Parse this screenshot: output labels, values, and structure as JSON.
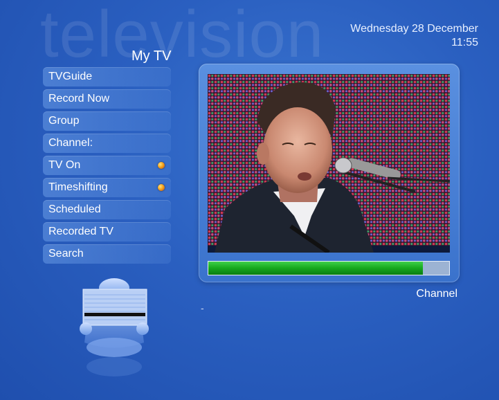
{
  "watermark": "television",
  "header": {
    "date": "Wednesday 28 December",
    "time": "11:55",
    "title": "My TV"
  },
  "menu": [
    {
      "label": "TVGuide",
      "indicator": false
    },
    {
      "label": "Record Now",
      "indicator": false
    },
    {
      "label": "Group",
      "indicator": false
    },
    {
      "label": "Channel:",
      "indicator": false
    },
    {
      "label": "TV On",
      "indicator": true
    },
    {
      "label": "Timeshifting",
      "indicator": true
    },
    {
      "label": "Scheduled",
      "indicator": false
    },
    {
      "label": "Recorded TV",
      "indicator": false
    },
    {
      "label": "Search",
      "indicator": false
    }
  ],
  "preview": {
    "progress_fraction": 0.89,
    "channel_label": "Channel",
    "program_info": "-"
  },
  "colors": {
    "indicator": "#f3a31f",
    "progress": "#16a81d"
  }
}
